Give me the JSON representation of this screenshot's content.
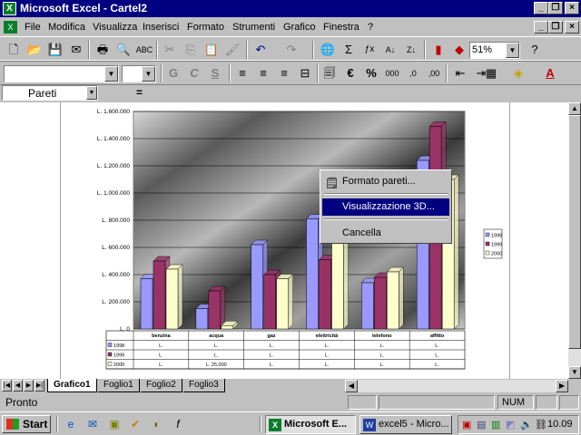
{
  "window": {
    "title": "Microsoft Excel - Cartel2",
    "app_icon": "excel-icon"
  },
  "menu": {
    "items": [
      "File",
      "Modifica",
      "Visualizza",
      "Inserisci",
      "Formato",
      "Strumenti",
      "Grafico",
      "Finestra",
      "?"
    ]
  },
  "toolbar": {
    "zoom": "51%",
    "bold": "G",
    "italic": "C",
    "underline": "S",
    "currency": "€",
    "percent": "%"
  },
  "formula_bar": {
    "name_box": "Pareti",
    "equals": "="
  },
  "chart_data": {
    "type": "bar",
    "categories": [
      "benzina",
      "acqua",
      "gaz",
      "elettricità",
      "telefono",
      "affitto"
    ],
    "series": [
      {
        "name": "1998",
        "color": "#9999ff",
        "values": [
          370000,
          150000,
          620000,
          810000,
          340000,
          1240000
        ]
      },
      {
        "name": "1999",
        "color": "#993366",
        "values": [
          500000,
          280000,
          400000,
          510000,
          380000,
          1490000
        ]
      },
      {
        "name": "2000",
        "color": "#ffffcc",
        "values": [
          440000,
          25000,
          370000,
          690000,
          420000,
          1100000
        ]
      }
    ],
    "ylim": [
      0,
      1600000
    ],
    "ytick_labels": [
      "L. 0",
      "L. 200.000",
      "L. 400.000",
      "L. 600.000",
      "L. 800.000",
      "L. 1.000.000",
      "L. 1.200.000",
      "L. 1.400.000",
      "L. 1.600.000"
    ],
    "legend_labels": [
      "1998",
      "1999",
      "2000"
    ],
    "table": {
      "row_labels": [
        "1998",
        "1999",
        "2000"
      ],
      "rows": [
        [
          "L.",
          "L.",
          "L.",
          "L.",
          "L.",
          "L."
        ],
        [
          "L.",
          "L.",
          "L.",
          "L.",
          "L.",
          "L."
        ],
        [
          "L.",
          "L. 25.000",
          "L.",
          "L.",
          "L.",
          "L."
        ]
      ]
    },
    "grid": true,
    "legend_placement": "right"
  },
  "context_menu": {
    "items": [
      "Formato pareti...",
      "Visualizzazione 3D...",
      "Cancella"
    ]
  },
  "sheet_tabs": [
    "Grafico1",
    "Foglio1",
    "Foglio2",
    "Foglio3"
  ],
  "status": {
    "text": "Pronto",
    "num": "NUM"
  },
  "taskbar": {
    "start": "Start",
    "tasks": [
      "Microsoft E...",
      "excel5 - Micro..."
    ],
    "clock": "10.09"
  }
}
